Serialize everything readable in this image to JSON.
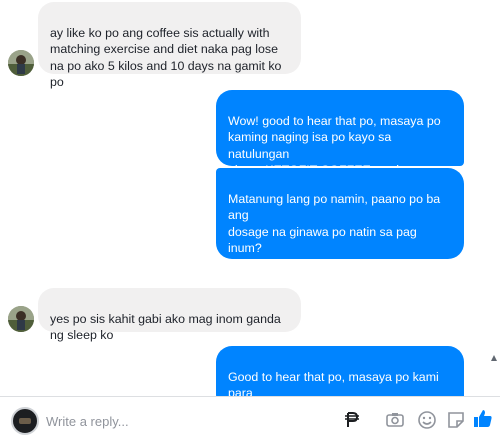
{
  "messages": [
    {
      "from": "them",
      "text": "ay like ko po ang coffee sis actually with\nmatching exercise and diet naka pag lose\nna po ako 5 kilos and 10 days na gamit ko\npo"
    },
    {
      "from": "me",
      "text": "Wow! good to hear that po, masaya po\nkaming naging isa po kayo sa natulungan\nnitong KETOFIT COFFEE product namin\npo."
    },
    {
      "from": "me",
      "text": "Matanung lang po namin, paano po ba ang\ndosage na ginawa po natin  sa pag inum?\npara ma e-share din po natin sa mga\ngustong mag bawas din po nang kanilang\ntimbang."
    },
    {
      "from": "them",
      "text": "yes po sis kahit gabi ako mag inom ganda\nng sleep ko"
    },
    {
      "from": "me",
      "text": "Good to hear that po, masaya po kami para\nsainyo po, which is yan po talaga ang MAIN\nGOAL nang company ang makatulong sa"
    }
  ],
  "composer": {
    "placeholder": "Write a reply...",
    "icons": [
      "peso-icon",
      "camera-icon",
      "emoji-icon",
      "sticker-icon",
      "like-icon"
    ],
    "accent": "#0084ff"
  }
}
